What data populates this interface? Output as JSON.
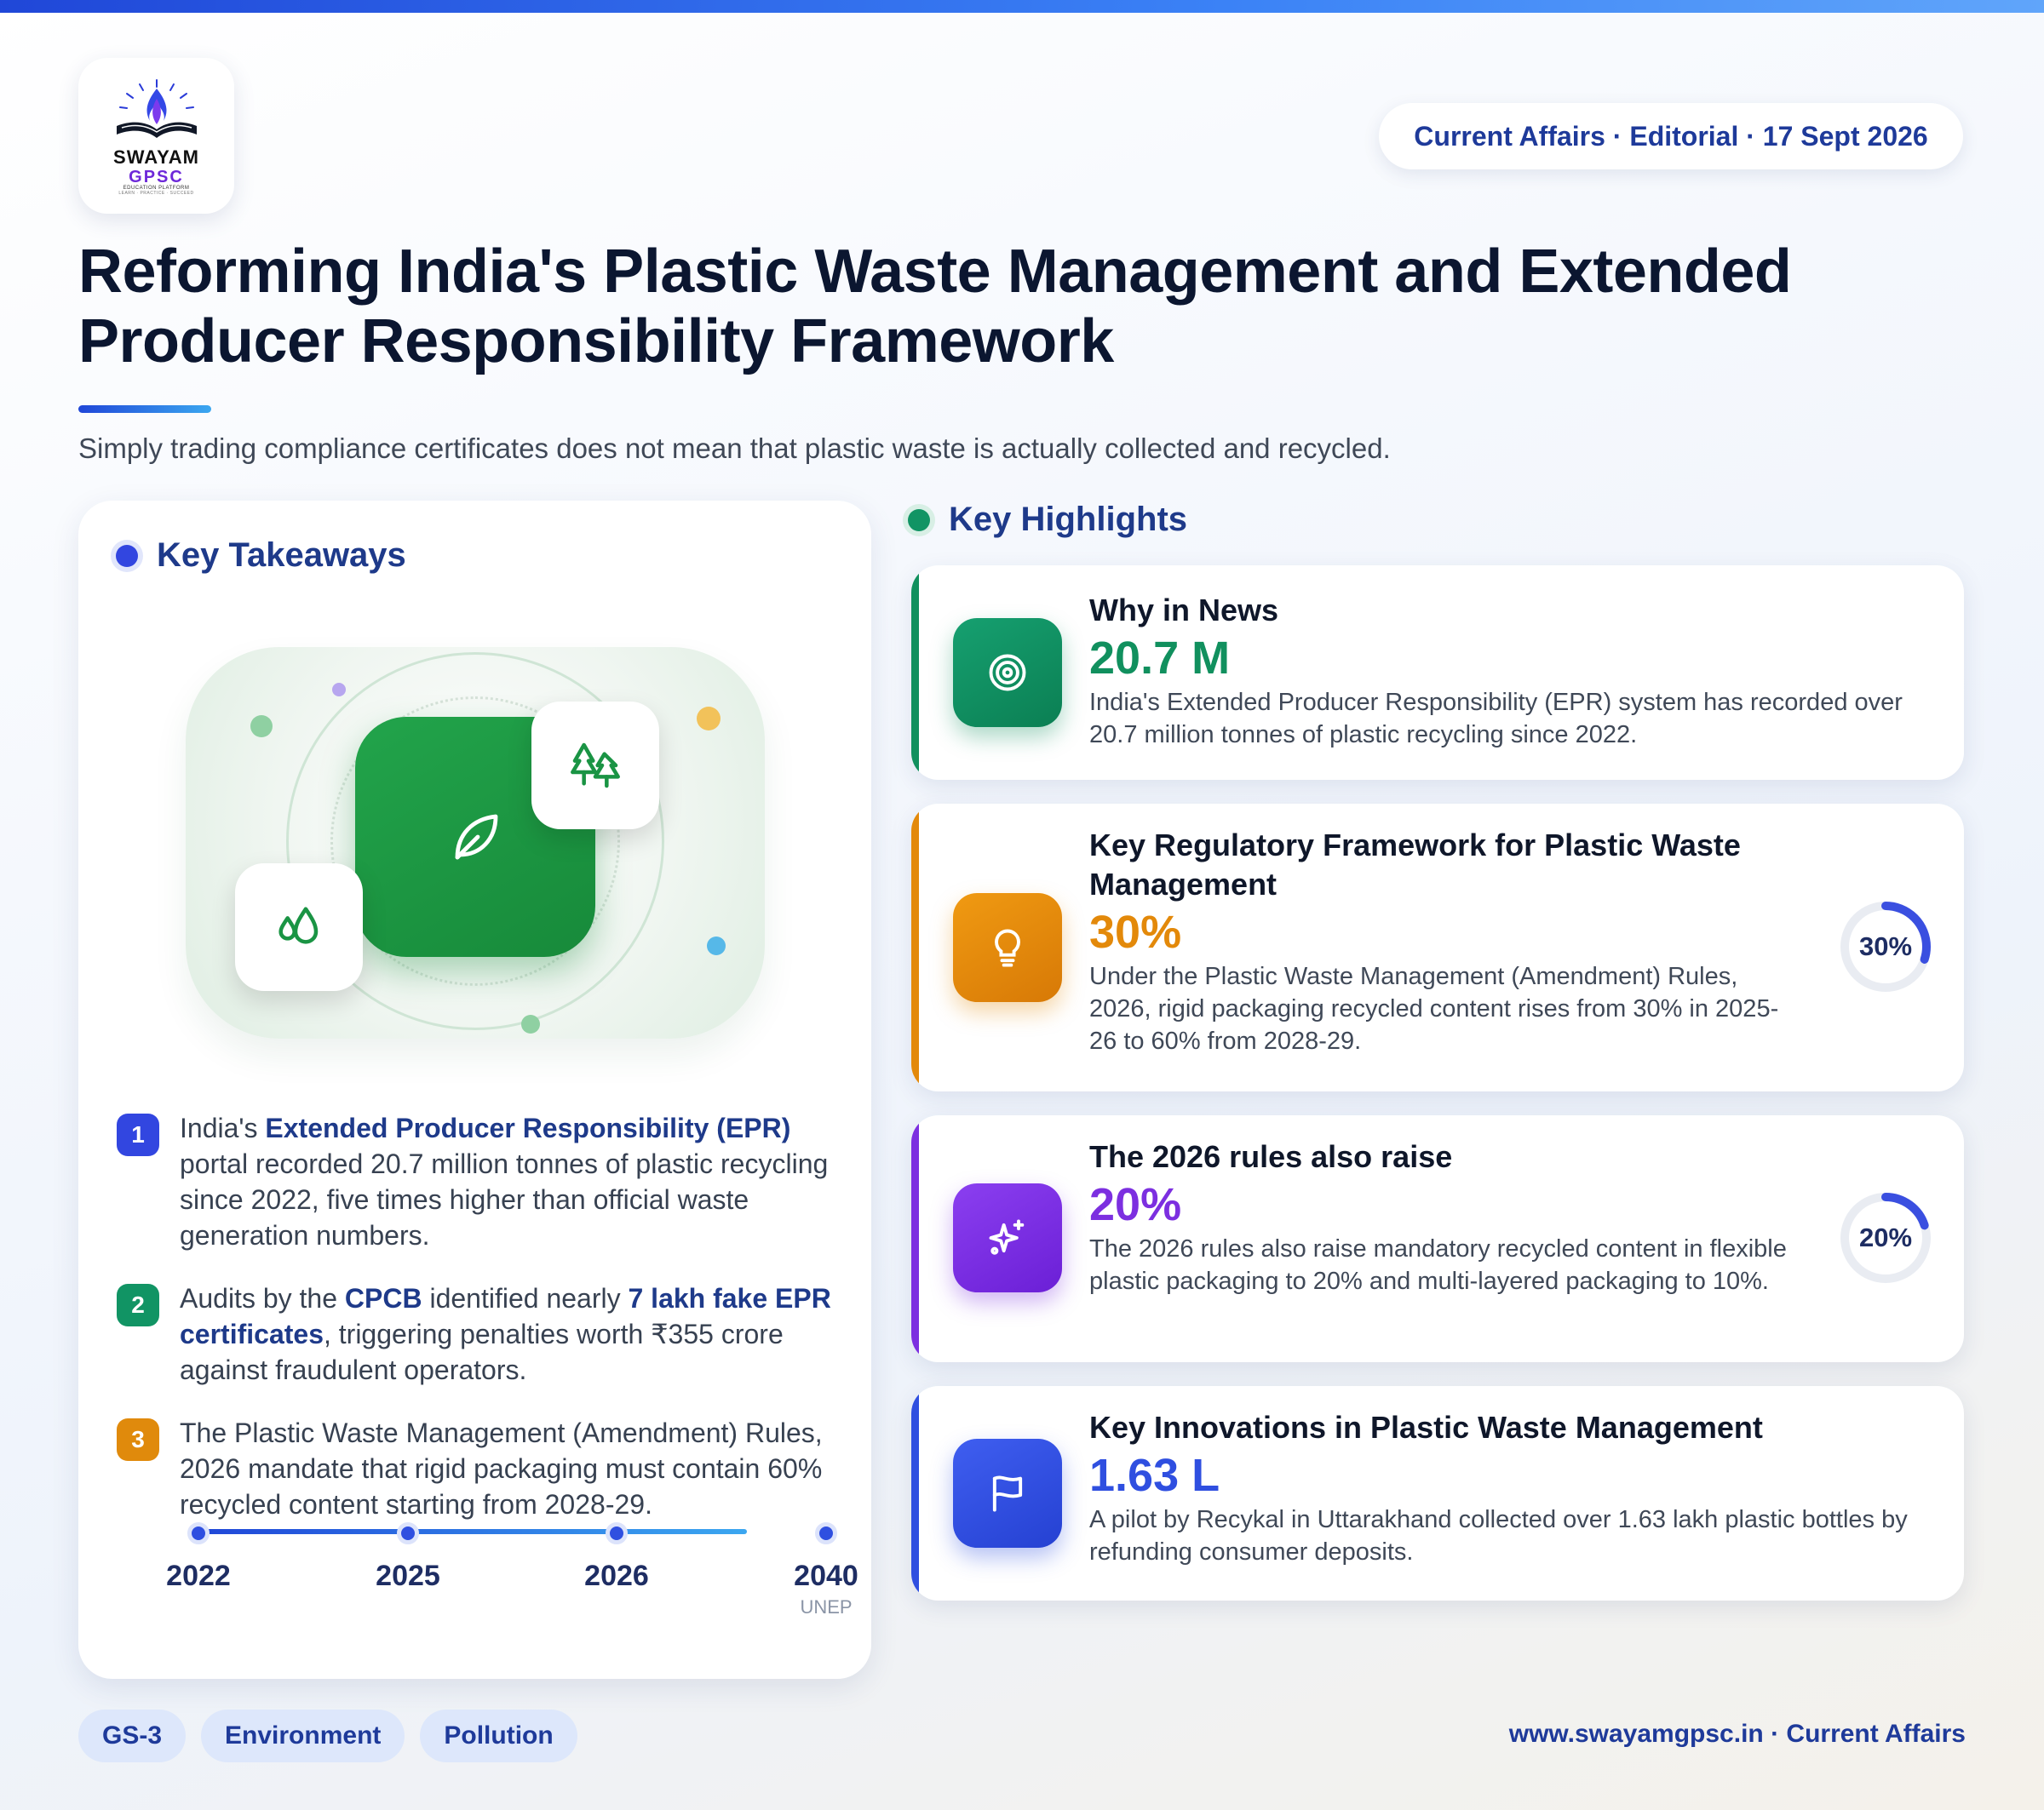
{
  "brand": {
    "logo_line1": "SWAYAM",
    "logo_line2": "GPSC",
    "logo_line3": "EDUCATION PLATFORM",
    "logo_line4": "LEARN · PRACTICE · SUCCEED"
  },
  "header": {
    "date_pill": "Current Affairs · Editorial · 17 Sept 2026",
    "title": "Reforming India's Plastic Waste Management and Extended Producer Responsibility Framework",
    "subtitle": "Simply trading compliance certificates does not mean that plastic waste is actually collected and recycled."
  },
  "takeaways": {
    "heading": "Key Takeaways",
    "items": [
      {
        "num": "1",
        "color": "#3246e0"
      },
      {
        "num": "2",
        "color": "#119464"
      },
      {
        "num": "3",
        "color": "#e08a0c"
      }
    ],
    "item1": {
      "a": "India's ",
      "b": "Extended Producer Responsibility (EPR)",
      "c": " portal recorded 20.7 million tonnes of plastic recycling since 2022, five times higher than official waste generation numbers."
    },
    "item2": {
      "a": "Audits by the ",
      "b": "CPCB",
      "c": " identified nearly ",
      "d": "7 lakh fake EPR certificates",
      "e": ", triggering penalties worth ₹355 crore against fraudulent operators."
    },
    "item3": {
      "a": "The Plastic Waste Management (Amendment) Rules, 2026 mandate that rigid packaging must contain 60% recycled content starting from 2028-29."
    },
    "timeline": [
      {
        "year": "2022",
        "note": ""
      },
      {
        "year": "2025",
        "note": ""
      },
      {
        "year": "2026",
        "note": ""
      },
      {
        "year": "2040",
        "note": "UNEP"
      }
    ],
    "icons": [
      "leaf-icon",
      "tree-icon",
      "water-drop-icon"
    ]
  },
  "highlights": {
    "heading": "Key Highlights",
    "cards": [
      {
        "title": "Why in News",
        "stat": "20.7 M",
        "desc": "India's Extended Producer Responsibility (EPR) system has recorded over 20.7 million tonnes of plastic recycling since 2022.",
        "accent": "#11905e",
        "icon": "target-icon"
      },
      {
        "title": "Key Regulatory Framework for Plastic Waste Management",
        "stat": "30%",
        "desc": "Under the Plastic Waste Management (Amendment) Rules, 2026, rigid packaging recycled content rises from 30% in 2025-26 to 60% from 2028-29.",
        "accent": "#e3890a",
        "icon": "lightbulb-icon",
        "gauge_label": "30%",
        "gauge_value": 0.3
      },
      {
        "title": "The 2026 rules also raise",
        "stat": "20%",
        "desc": "The 2026 rules also raise mandatory recycled content in flexible plastic packaging to 20% and multi-layered packaging to 10%.",
        "accent": "#7c2fe0",
        "icon": "sparkle-icon",
        "gauge_label": "20%",
        "gauge_value": 0.2
      },
      {
        "title": "Key Innovations in Plastic Waste Management",
        "stat": "1.63 L",
        "desc": "A pilot by Recykal in Uttarakhand collected over 1.63 lakh plastic bottles by refunding consumer deposits.",
        "accent": "#2f4fe0",
        "icon": "flag-icon"
      }
    ]
  },
  "footer": {
    "tags": [
      "GS-3",
      "Environment",
      "Pollution"
    ],
    "site": "www.swayamgpsc.in · Current Affairs"
  },
  "colors": {
    "primary": "#1e3a9a",
    "green": "#11905e",
    "orange": "#e3890a",
    "purple": "#7c2fe0",
    "blue": "#2f4fe0"
  }
}
